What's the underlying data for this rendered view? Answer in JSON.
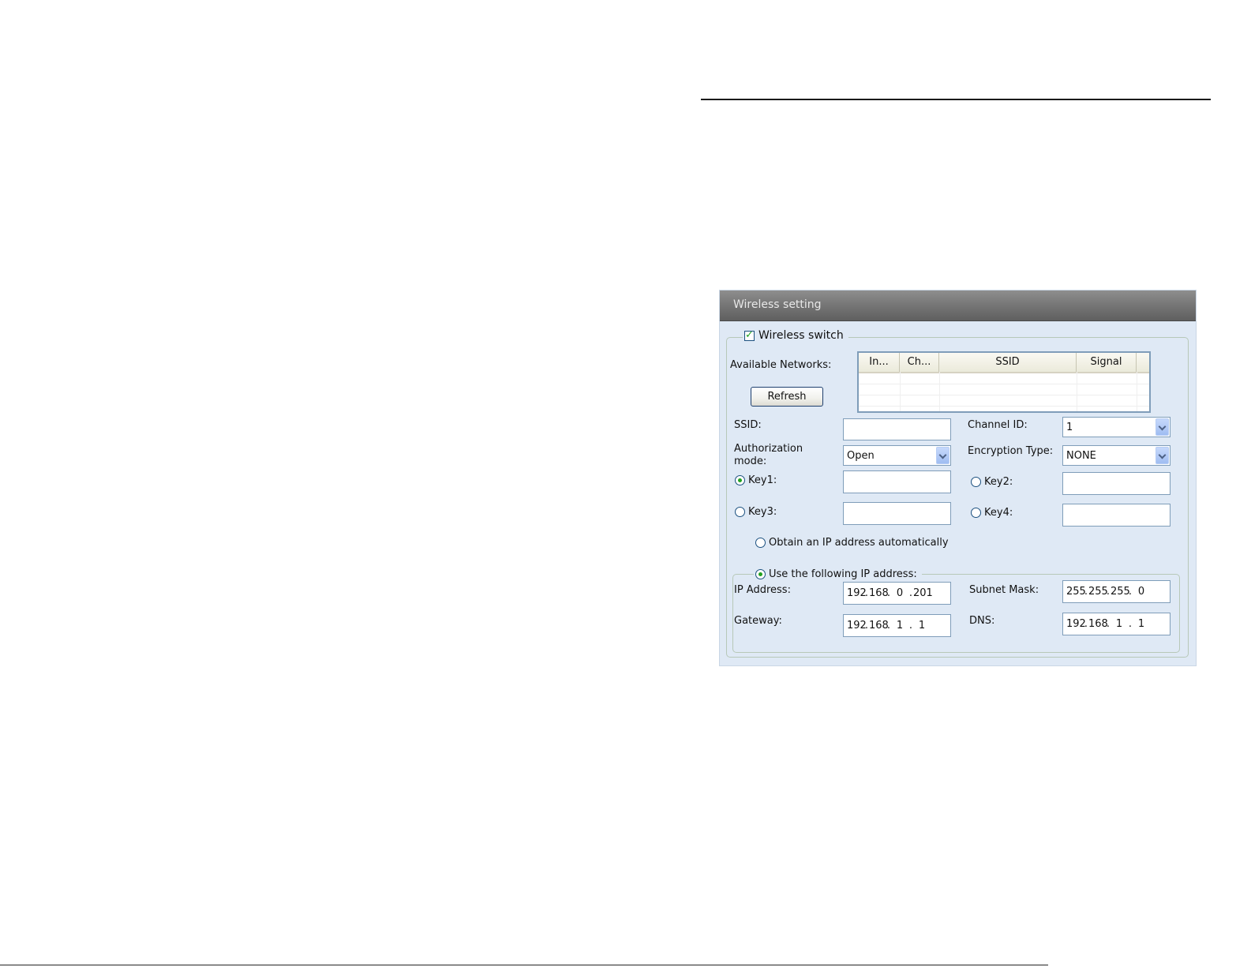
{
  "dialog": {
    "title": "Wireless setting",
    "wireless_switch": {
      "label": "Wireless switch",
      "checked": true
    },
    "available_networks": {
      "label": "Available Networks:",
      "refresh_label": "Refresh",
      "columns": [
        "In...",
        "Ch...",
        "SSID",
        "Signal"
      ],
      "rows": []
    },
    "ssid": {
      "label": "SSID:",
      "value": ""
    },
    "channel_id": {
      "label": "Channel ID:",
      "value": "1"
    },
    "authorization_mode": {
      "label_line1": "Authorization",
      "label_line2": "mode:",
      "value": "Open"
    },
    "encryption_type": {
      "label": "Encryption Type:",
      "value": "NONE"
    },
    "keys": [
      {
        "label": "Key1:",
        "selected": true,
        "value": ""
      },
      {
        "label": "Key2:",
        "selected": false,
        "value": ""
      },
      {
        "label": "Key3:",
        "selected": false,
        "value": ""
      },
      {
        "label": "Key4:",
        "selected": false,
        "value": ""
      }
    ],
    "ip_mode": {
      "auto_label": "Obtain an IP address automatically",
      "manual_label": "Use the following IP address:",
      "selected": "manual"
    },
    "ip_address": {
      "label": "IP Address:",
      "octets": [
        "192",
        "168",
        "0",
        "201"
      ]
    },
    "subnet_mask": {
      "label": "Subnet Mask:",
      "octets": [
        "255",
        "255",
        "255",
        "0"
      ]
    },
    "gateway": {
      "label": "Gateway:",
      "octets": [
        "192",
        "168",
        "1",
        "1"
      ]
    },
    "dns": {
      "label": "DNS:",
      "octets": [
        "192",
        "168",
        "1",
        "1"
      ]
    }
  },
  "colors": {
    "dialog_bg": "#dfe9f5",
    "titlebar": "#7a7a7a",
    "accent_check": "#21a121",
    "input_border": "#7f9db9"
  }
}
